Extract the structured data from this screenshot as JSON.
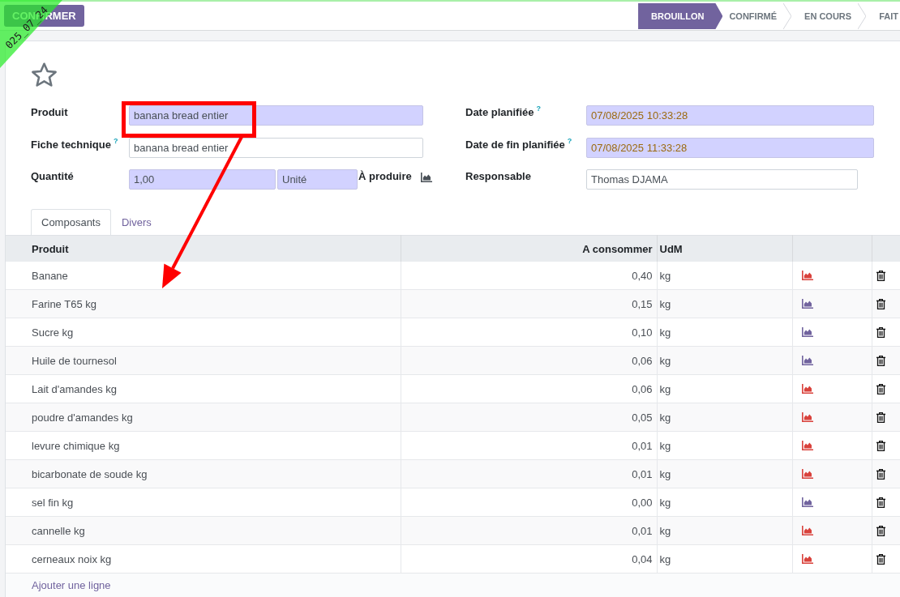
{
  "environment_ribbon": {
    "text": "025_07_24"
  },
  "control_panel": {
    "buttons": [
      "CONFIRMER"
    ],
    "status_steps": [
      {
        "label": "BROUILLON",
        "selected": true
      },
      {
        "label": "CONFIRMÉ",
        "selected": false
      },
      {
        "label": "EN COURS",
        "selected": false
      },
      {
        "label": "FAIT",
        "selected": false
      }
    ]
  },
  "form": {
    "starred": false,
    "left_fields": [
      {
        "kind": "text",
        "label": "Produit",
        "value": "banana bread entier",
        "required": true
      },
      {
        "kind": "text",
        "label": "Fiche technique",
        "help": "?",
        "value": "banana bread entier",
        "required": false
      },
      {
        "kind": "quantity",
        "label": "Quantité",
        "value": "1,00",
        "unit": "Unité",
        "required": true,
        "note": "À produire"
      }
    ],
    "right_fields": [
      {
        "kind": "text",
        "label": "Date planifiée",
        "help": "?",
        "value": "07/08/2025 10:33:28",
        "required": true,
        "warning": true
      },
      {
        "kind": "text",
        "label": "Date de fin planifiée",
        "help": "?",
        "value": "07/08/2025 11:33:28",
        "required": true,
        "warning": true
      },
      {
        "kind": "user",
        "label": "Responsable",
        "value": "Thomas DJAMA",
        "required": false
      }
    ]
  },
  "tabs": [
    {
      "label": "Composants",
      "selected": true
    },
    {
      "label": "Divers",
      "selected": false
    }
  ],
  "table": {
    "columns": [
      "Produit",
      "A consommer",
      "UdM"
    ],
    "rows": [
      {
        "product": "Banane",
        "quantity": "0,40",
        "uom": "kg",
        "color": "#d9423c"
      },
      {
        "product": "Farine T65 kg",
        "quantity": "0,15",
        "uom": "kg",
        "color": "#71639e"
      },
      {
        "product": "Sucre kg",
        "quantity": "0,10",
        "uom": "kg",
        "color": "#71639e"
      },
      {
        "product": "Huile de tournesol",
        "quantity": "0,06",
        "uom": "kg",
        "color": "#71639e"
      },
      {
        "product": "Lait d'amandes kg",
        "quantity": "0,06",
        "uom": "kg",
        "color": "#d9423c"
      },
      {
        "product": "poudre d'amandes kg",
        "quantity": "0,05",
        "uom": "kg",
        "color": "#d9423c"
      },
      {
        "product": "levure chimique kg",
        "quantity": "0,01",
        "uom": "kg",
        "color": "#d9423c"
      },
      {
        "product": "bicarbonate de soude kg",
        "quantity": "0,01",
        "uom": "kg",
        "color": "#d9423c"
      },
      {
        "product": "sel fin kg",
        "quantity": "0,00",
        "uom": "kg",
        "color": "#71639e"
      },
      {
        "product": "cannelle kg",
        "quantity": "0,01",
        "uom": "kg",
        "color": "#d9423c"
      },
      {
        "product": "cerneaux noix kg",
        "quantity": "0,04",
        "uom": "kg",
        "color": "#d9423c"
      }
    ],
    "add_line": "Ajouter une ligne"
  },
  "annotations": [
    {
      "kind": "box"
    },
    {
      "kind": "arrow"
    }
  ]
}
